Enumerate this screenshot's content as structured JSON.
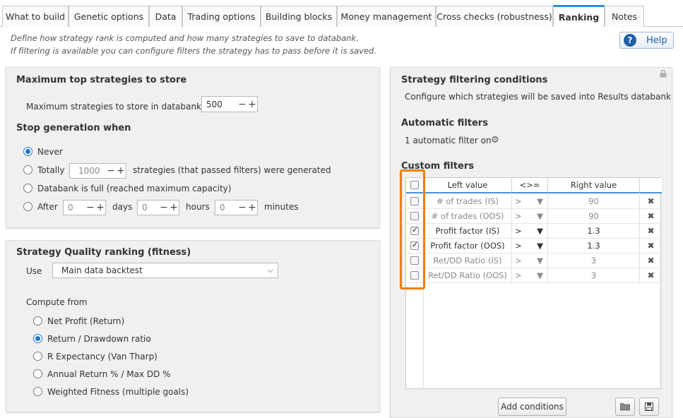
{
  "tabs": [
    {
      "label": "What to build"
    },
    {
      "label": "Genetic options"
    },
    {
      "label": "Data"
    },
    {
      "label": "Trading options"
    },
    {
      "label": "Building blocks"
    },
    {
      "label": "Money management"
    },
    {
      "label": "Cross checks (robustness)"
    },
    {
      "label": "Ranking",
      "active": true
    },
    {
      "label": "Notes"
    }
  ],
  "description": {
    "line1": "Define how strategy rank is computed and how many strategies to save to databank.",
    "line2": "If filtering is available you can configure filters the strategy has to pass before it is saved."
  },
  "help_button": {
    "label": "Help",
    "icon": "question-circle-icon"
  },
  "max_top": {
    "title": "Maximum top strategies to store",
    "label": "Maximum strategies to store in databank",
    "value": "500"
  },
  "stop_generation": {
    "title": "Stop generation when",
    "options": {
      "never": "Never",
      "totally": "Totally",
      "totally_value": "1000",
      "totally_suffix": "strategies (that passed filters) were generated",
      "databank_full": "Databank is full (reached maximum capacity)",
      "after": "After",
      "days_value": "0",
      "days_label": "days",
      "hours_value": "0",
      "hours_label": "hours",
      "minutes_value": "0",
      "minutes_label": "minutes"
    },
    "selected": "never"
  },
  "quality": {
    "title": "Strategy Quality ranking (fitness)",
    "use_label": "Use",
    "use_value": "Main data backtest",
    "compute_from": "Compute from",
    "options": [
      "Net Profit (Return)",
      "Return / Drawdown ratio",
      "R Expectancy (Van Tharp)",
      "Annual Return % / Max DD %",
      "Weighted Fitness (multiple goals)"
    ],
    "selected_index": 1
  },
  "filtering": {
    "title": "Strategy filtering conditions",
    "subtitle": "Configure which strategies will be saved into Results databank",
    "auto_title": "Automatic filters",
    "auto_status": "1 automatic filter on",
    "custom_title": "Custom filters",
    "columns": {
      "left": "Left value",
      "op": "<>=",
      "right": "Right value"
    },
    "rows": [
      {
        "checked": false,
        "left": "# of trades (IS)",
        "op": ">",
        "right": "90"
      },
      {
        "checked": false,
        "left": "# of trades (OOS)",
        "op": ">",
        "right": "90"
      },
      {
        "checked": true,
        "left": "Profit factor (IS)",
        "op": ">",
        "right": "1.3"
      },
      {
        "checked": true,
        "left": "Profit factor (OOS)",
        "op": ">",
        "right": "1.3"
      },
      {
        "checked": false,
        "left": "Ret/DD Ratio (IS)",
        "op": ">",
        "right": "3"
      },
      {
        "checked": false,
        "left": "Ret/DD Ratio (OOS)",
        "op": ">",
        "right": "3"
      }
    ],
    "add_button": "Add conditions",
    "accent_highlight": "#f08000"
  }
}
